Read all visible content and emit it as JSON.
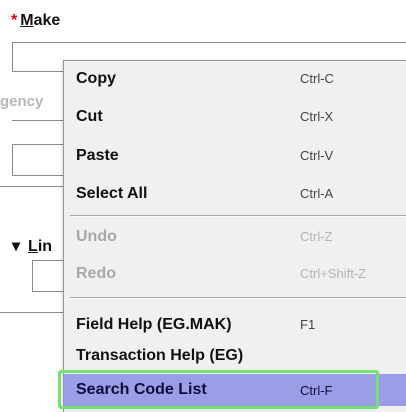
{
  "form": {
    "make_required_mark": "*",
    "make_label_first": "M",
    "make_label_rest": "ake",
    "agency_label_fragment": "gency",
    "lin_prefix": "▾",
    "lin_label_first": "L",
    "lin_label_rest": "in"
  },
  "menu": {
    "items": [
      {
        "label": "Copy",
        "shortcut": "Ctrl-C",
        "enabled": true
      },
      {
        "label": "Cut",
        "shortcut": "Ctrl-X",
        "enabled": true
      },
      {
        "label": "Paste",
        "shortcut": "Ctrl-V",
        "enabled": true
      },
      {
        "label": "Select All",
        "shortcut": "Ctrl-A",
        "enabled": true
      },
      {
        "label": "Undo",
        "shortcut": "Ctrl-Z",
        "enabled": false
      },
      {
        "label": "Redo",
        "shortcut": "Ctrl+Shift-Z",
        "enabled": false
      },
      {
        "label": "Field Help (EG.MAK)",
        "shortcut": "F1",
        "enabled": true
      },
      {
        "label": "Transaction Help (EG)",
        "shortcut": "",
        "enabled": true
      },
      {
        "label": "Search Code List",
        "shortcut": "Ctrl-F",
        "enabled": true,
        "highlighted": true
      }
    ]
  },
  "colors": {
    "highlight": "#9b9ee6",
    "focus_ring": "#6fe26f",
    "required": "#e00000"
  }
}
